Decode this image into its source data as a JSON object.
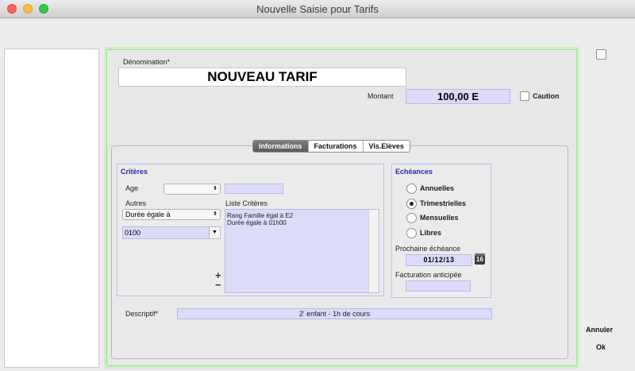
{
  "window": {
    "title": "Nouvelle Saisie pour Tarifs"
  },
  "header": {
    "denomination_label": "Dénomination*",
    "denomination_value": "NOUVEAU TARIF",
    "montant_label": "Montant",
    "montant_value": "100,00 E",
    "caution_label": "Caution"
  },
  "tabs": [
    {
      "label": "Informations",
      "active": true
    },
    {
      "label": "Facturations",
      "active": false
    },
    {
      "label": "Vis.Elèves",
      "active": false
    }
  ],
  "criteres": {
    "title": "Critères",
    "age_label": "Age",
    "age_value": "",
    "age_field_value": "",
    "autres_label": "Autres",
    "autres_value": "Durée égale à",
    "combo_value": "0100",
    "liste_label": "Liste Critères",
    "liste_items": [
      "Rang Famille égal à E2",
      "Durée égale à 01h00"
    ],
    "plus": "+",
    "minus": "−"
  },
  "echeances": {
    "title": "Echéances",
    "options": [
      {
        "label": "Annuelles",
        "selected": false
      },
      {
        "label": "Trimestrielles",
        "selected": true
      },
      {
        "label": "Mensuelles",
        "selected": false
      },
      {
        "label": "Libres",
        "selected": false
      }
    ],
    "prochaine_label": "Prochaine échéance",
    "prochaine_value": "01/12/13",
    "calendar_day": "16",
    "facturation_label": "Facturation anticipée",
    "facturation_value": ""
  },
  "descriptif": {
    "label": "Descriptif*",
    "value": "2' enfant - 1h de cours"
  },
  "actions": {
    "cancel": "Annuler",
    "ok": "Ok"
  },
  "colors": {
    "field_blue": "#dcdcfa",
    "group_border": "#b8bfe6",
    "group_title": "#2a2aa5",
    "focus_ring": "#c9f4c0"
  },
  "icons": {
    "calendar": "calendar-icon",
    "popup": "chevron-updown-icon",
    "combo": "chevron-down-icon"
  }
}
